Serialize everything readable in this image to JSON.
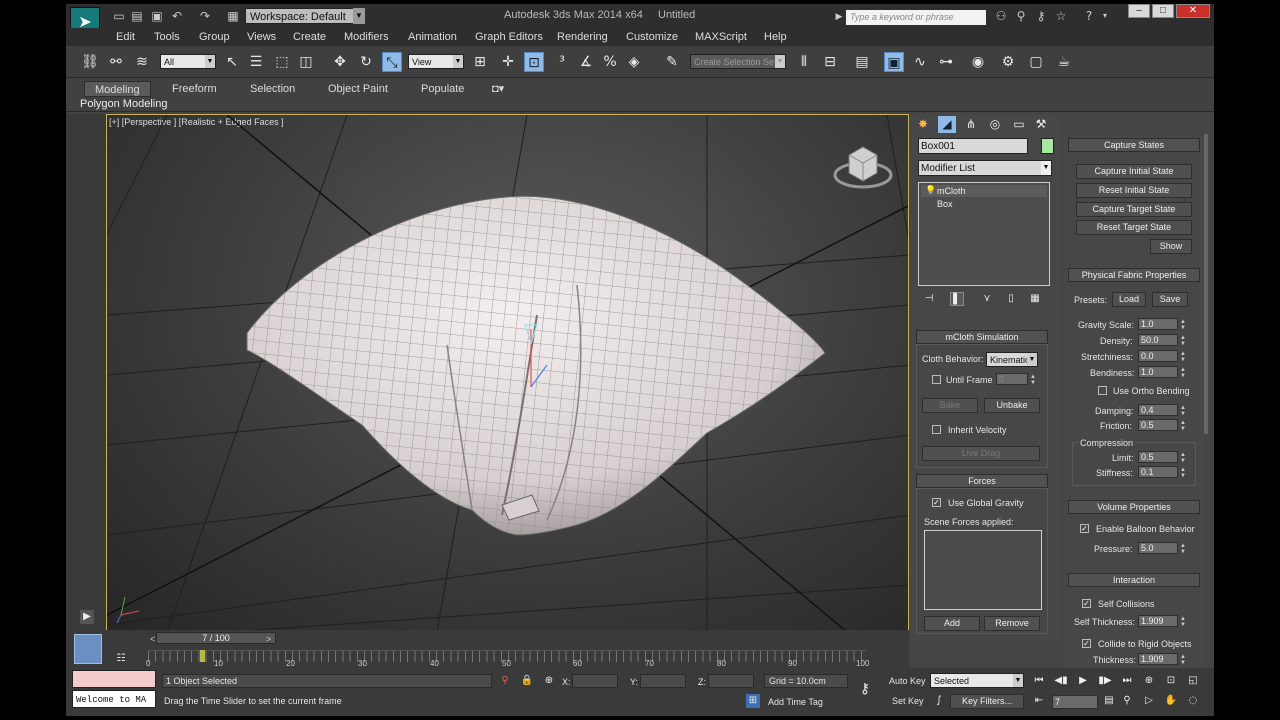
{
  "title": {
    "workspace": "Workspace: Default",
    "app": "Autodesk 3ds Max  2014 x64",
    "doc": "Untitled",
    "search_placeholder": "Type a keyword or phrase"
  },
  "menu": [
    "Edit",
    "Tools",
    "Group",
    "Views",
    "Create",
    "Modifiers",
    "Animation",
    "Graph Editors",
    "Rendering",
    "Customize",
    "MAXScript",
    "Help"
  ],
  "toolbar": {
    "filter": "All",
    "refcoord": "View",
    "selection_set": "Create Selection Se"
  },
  "ribbon": {
    "tabs": [
      "Modeling",
      "Freeform",
      "Selection",
      "Object Paint",
      "Populate"
    ],
    "sub": "Polygon Modeling"
  },
  "viewport": {
    "label": "[+] [Perspective ] [Realistic + Edged Faces ]"
  },
  "command_panel": {
    "object_name": "Box001",
    "modifier_list": "Modifier List",
    "stack": [
      "mCloth",
      "Box"
    ],
    "mcloth_sim": {
      "title": "mCloth Simulation",
      "behavior_label": "Cloth Behavior:",
      "behavior_value": "Kinematic",
      "until_frame": "Until Frame",
      "until_frame_value": "0",
      "bake": "Bake",
      "unbake": "Unbake",
      "inherit_velocity": "Inherit Velocity",
      "live_drag": "Live Drag"
    },
    "forces": {
      "title": "Forces",
      "use_global_gravity": "Use Global Gravity",
      "scene_forces": "Scene Forces applied:",
      "add": "Add",
      "remove": "Remove"
    }
  },
  "right_panel": {
    "capture": {
      "title": "Capture States",
      "buttons": [
        "Capture Initial State",
        "Reset Initial State",
        "Capture Target State",
        "Reset Target State",
        "Show"
      ]
    },
    "fabric": {
      "title": "Physical Fabric Properties",
      "presets": "Presets:",
      "load": "Load",
      "save": "Save",
      "gravity_scale": "Gravity Scale:",
      "gravity_scale_val": "1.0",
      "density": "Density:",
      "density_val": "50.0",
      "stretchiness": "Stretchiness:",
      "stretchiness_val": "0.0",
      "bendiness": "Bendiness:",
      "bendiness_val": "1.0",
      "ortho": "Use Ortho Bending",
      "damping": "Damping:",
      "damping_val": "0.4",
      "friction": "Friction:",
      "friction_val": "0.5",
      "compression": "Compression",
      "limit": "Limit:",
      "limit_val": "0.5",
      "stiffness": "Stiffness:",
      "stiffness_val": "0.1"
    },
    "volume": {
      "title": "Volume Properties",
      "balloon": "Enable Balloon Behavior",
      "pressure": "Pressure:",
      "pressure_val": "5.0"
    },
    "interaction": {
      "title": "Interaction",
      "self_collisions": "Self Collisions",
      "self_thickness": "Self Thickness:",
      "self_thickness_val": "1.909",
      "collide_rigid": "Collide to Rigid Objects",
      "thickness": "Thickness:",
      "thickness_val": "1.909"
    }
  },
  "timeline": {
    "slider": "7 / 100",
    "ticks": [
      "0",
      "10",
      "20",
      "30",
      "40",
      "50",
      "60",
      "70",
      "80",
      "90",
      "100"
    ]
  },
  "status": {
    "welcome": "Welcome to MA",
    "selected": "1 Object Selected",
    "prompt": "Drag the Time Slider to set the current frame",
    "x_label": "X:",
    "y_label": "Y:",
    "z_label": "Z:",
    "grid": "Grid = 10.0cm",
    "add_time_tag": "Add Time Tag",
    "auto_key": "Auto Key",
    "set_key": "Set Key",
    "selected_dd": "Selected",
    "key_filters": "Key Filters...",
    "frame": "7"
  }
}
